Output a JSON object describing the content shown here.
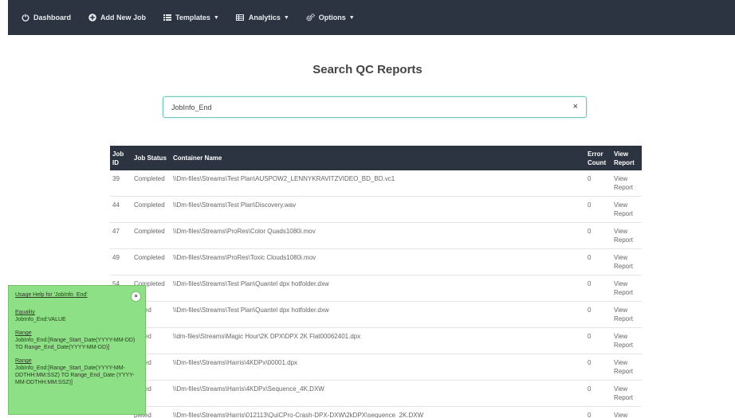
{
  "navbar": {
    "items": [
      {
        "label": "Dashboard",
        "icon": "power-icon"
      },
      {
        "label": "Add New Job",
        "icon": "plus-circle-icon"
      },
      {
        "label": "Templates",
        "icon": "list-icon",
        "dropdown": true
      },
      {
        "label": "Analytics",
        "icon": "table-icon",
        "dropdown": true
      },
      {
        "label": "Options",
        "icon": "gears-icon",
        "dropdown": true
      }
    ]
  },
  "page": {
    "title": "Search QC Reports"
  },
  "search": {
    "value": "JobInfo_End",
    "clear": "×"
  },
  "table": {
    "headers": [
      "Job ID",
      "Job Status",
      "Container Name",
      "Error Count",
      "View Report"
    ],
    "rows": [
      {
        "id": "39",
        "status": "Completed",
        "name": "\\\\Dm-files\\Streams\\Test Plan\\AUSPOW2_LENNYKRAVITZVIDEO_BD_BD.vc1",
        "errors": "0",
        "view": "View Report"
      },
      {
        "id": "44",
        "status": "Completed",
        "name": "\\\\Dm-files\\Streams\\Test Plan\\Discovery.wav",
        "errors": "0",
        "view": "View Report"
      },
      {
        "id": "47",
        "status": "Completed",
        "name": "\\\\Dm-files\\Streams\\ProRes\\Color Quads1080i.mov",
        "errors": "0",
        "view": "View Report"
      },
      {
        "id": "49",
        "status": "Completed",
        "name": "\\\\Dm-files\\Streams\\ProRes\\Toxic Clouds1080i.mov",
        "errors": "0",
        "view": "View Report"
      },
      {
        "id": "54",
        "status": "Completed",
        "name": "\\\\Dm-files\\Streams\\Test Plan\\Quantel dpx hotfolder.dxw",
        "errors": "0",
        "view": "View Report"
      },
      {
        "id": "",
        "status": "pleted",
        "name": "\\\\Dm-files\\Streams\\Test Plan\\Quantel dpx hotfolder.dxw",
        "errors": "0",
        "view": "View Report"
      },
      {
        "id": "",
        "status": "pleted",
        "name": "\\\\dm-files\\Streams\\Magic Hour\\2K DPX\\DPX 2K Flat00062401.dpx",
        "errors": "0",
        "view": "View Report"
      },
      {
        "id": "",
        "status": "pleted",
        "name": "\\\\Dm-files\\Streams\\Harris\\4KDPx\\00001.dpx",
        "errors": "0",
        "view": "View Report"
      },
      {
        "id": "",
        "status": "pleted",
        "name": "\\\\Dm-files\\Streams\\Harris\\4KDPx\\Sequence_4K.DXW",
        "errors": "0",
        "view": "View Report"
      },
      {
        "id": "",
        "status": "pleted",
        "name": "\\\\Dm-files\\Streams\\Harris\\012113\\QuiCPro-Crash-DPX-DXW\\2kDPX\\sequence_2K.DXW",
        "errors": "0",
        "view": "View Report"
      }
    ]
  },
  "help": {
    "title": "Usage Help for 'JobInfo_End'",
    "close": "×",
    "sections": [
      {
        "heading": "Equality",
        "text": "JobInfo_End:VALUE"
      },
      {
        "heading": "Range",
        "text": "JobInfo_End:[Range_Start_Date(YYYY-MM-DD) TO Range_End_Date(YYYY-MM-DD)]"
      },
      {
        "heading": "Range",
        "text": "JobInfo_End:[Range_Start_Date(YYYY-MM-DDTHH:MM:SSZ) TO Range_End_Date (YYYY-MM-DDTHH:MM:SSZ)]"
      }
    ]
  },
  "colors": {
    "navbar": "#2b3440",
    "table_header": "#2b3440",
    "help_bg": "#8ee086",
    "search_border": "#6ac6b8"
  }
}
